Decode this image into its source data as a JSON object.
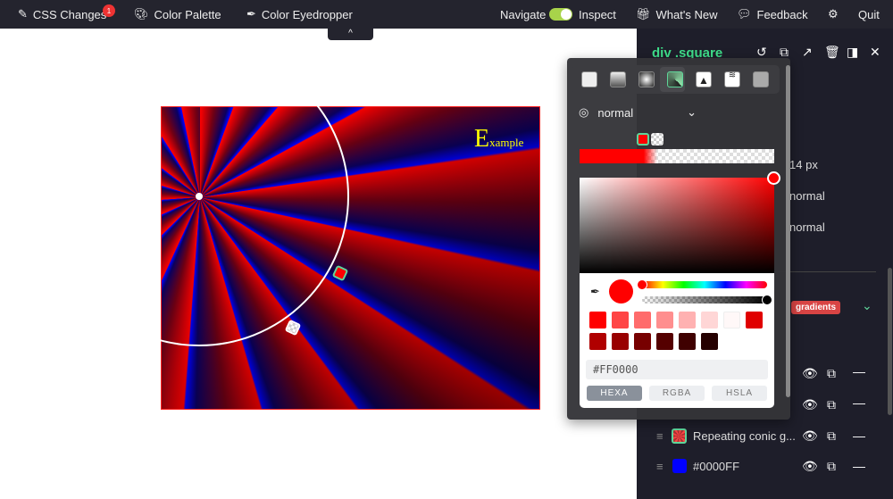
{
  "topbar": {
    "css_changes": "CSS Changes",
    "css_changes_count": "1",
    "color_palette": "Color Palette",
    "eyedropper": "Color Eyedropper",
    "navigate": "Navigate",
    "inspect": "Inspect",
    "whats_new": "What's New",
    "feedback": "Feedback",
    "quit": "Quit",
    "collapse": "^"
  },
  "canvas": {
    "example_big": "E",
    "example_rest": "xample"
  },
  "panel": {
    "selector": "div .square",
    "font_size_value": "14",
    "font_size_unit": "px",
    "font_weight": "normal",
    "font_style": "normal",
    "tag": "gradients",
    "layers": [
      {
        "label": "Repeating conic g..."
      },
      {
        "label": "#0000FF",
        "color": "#0000FF"
      }
    ]
  },
  "popup": {
    "blend_mode": "normal",
    "hex_value": "#FF0000",
    "formats": [
      "HEXA",
      "RGBA",
      "HSLA"
    ],
    "active_format": "HEXA",
    "current_color": "#FF0000",
    "swatches": [
      "#FF0000",
      "#FF4545",
      "#FF6B6B",
      "#FF8E8E",
      "#FFB1B1",
      "#FFD6D6",
      "#FFF8F8",
      "#E00000",
      "#B00000",
      "#990000",
      "#770000",
      "#550000",
      "#3F0000",
      "#250000"
    ]
  }
}
